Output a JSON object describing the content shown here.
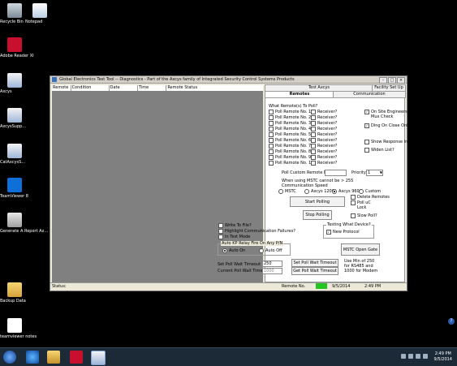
{
  "desktop": {
    "icons": [
      {
        "label": "Recycle Bin",
        "icon": "recycle-bin-icon"
      },
      {
        "label": "Notepad",
        "icon": "notepad-icon"
      },
      {
        "label": "Adobe Reader XI",
        "icon": "adobe-reader-icon"
      },
      {
        "label": "Axcys",
        "icon": "axcys-icon"
      },
      {
        "label": "AxcysSupp...",
        "icon": "axcys-support-icon"
      },
      {
        "label": "CatAxcysS...",
        "icon": "cat-axcys-icon"
      },
      {
        "label": "TeamViewer 8",
        "icon": "teamviewer-icon"
      },
      {
        "label": "Generate A Report Ax...",
        "icon": "report-icon"
      },
      {
        "label": "Backup Data",
        "icon": "folder-icon"
      },
      {
        "label": "teamviewer notes",
        "icon": "document-icon"
      }
    ]
  },
  "window": {
    "title": "Global Electronics Test Tool -- Diagnostics - Part of the Axcys family of Integrated Security Control Systems Products",
    "controls": {
      "minimize": "–",
      "maximize": "□",
      "close": "×"
    },
    "list_columns": [
      "Remote",
      "Condition",
      "Date",
      "Time",
      "Remote Status"
    ],
    "tabs": {
      "row1": [
        "Test Axcys",
        "Facility Set Up"
      ],
      "row2": [
        "Remotes",
        "Communication"
      ]
    },
    "remotes": {
      "section_label": "What Remote(s) To Poll?",
      "poll_items": [
        "Poll Remote No. 1",
        "Poll Remote No. 2",
        "Poll Remote No. 3",
        "Poll Remote No. 4",
        "Poll Remote No. 5",
        "Poll Remote No. 6",
        "Poll Remote No. 7",
        "Poll Remote No. 8",
        "Poll Remote No. 9",
        "Poll Remote No. 10"
      ],
      "receiver_label": "Receiver?",
      "options": [
        {
          "label": "On Site Engineers Mux Check",
          "checked": true
        },
        {
          "label": "Ding On Close Only",
          "checked": true
        },
        {
          "label": "Show Response In Hex",
          "checked": false
        },
        {
          "label": "Widen List?",
          "checked": false
        }
      ],
      "poll_custom_label": "Poll Custom Remote No.",
      "priority_label": "Priority",
      "priority_value": "1",
      "mstc_note": "When using MSTC cannot be > 255",
      "comm_speed_label": "Communication Speed",
      "speeds": [
        {
          "label": "MSTC",
          "selected": false
        },
        {
          "label": "Axcys 1200",
          "selected": false
        },
        {
          "label": "Axcys 9600",
          "selected": true
        },
        {
          "label": "Custom",
          "selected": false
        }
      ],
      "start_polling": "Start Polling",
      "stop_polling": "Stop Polling",
      "side_checks": [
        "Delete Remotes",
        "Poll uC Lock",
        "Slow Poll?"
      ],
      "write_to_file": "Write To File?",
      "highlight_failures": "Highlight Communication Failures?",
      "in_test_mode": "In Test Mode",
      "testing_what_device": "Testing What Device?",
      "new_protocol": "New Protocol",
      "auto_kp_label": "Auto KP Relay Fire On Any P/N",
      "auto_on": "Auto On",
      "auto_off": "Auto Off",
      "mstc_open_gate": "MSTC Open Gate",
      "set_poll_wait_timeout_label": "Set Poll Wait Timeout",
      "set_poll_wait_value": "250",
      "current_poll_wait_label": "Current Poll Wait Timeout",
      "current_poll_wait_value": "1000",
      "set_poll_wait_button": "Set Poll Wait Timeout",
      "get_poll_wait_button": "Get Poll Wait Timeout",
      "timeout_note": "Use Min of 250 for RS485 and 1000 for Modem"
    },
    "status": {
      "status_label": "Status:",
      "remote_no_label": "Remote No.",
      "date": "9/5/2014",
      "time": "2:49 PM",
      "indicator_color": "#22c522"
    }
  },
  "taskbar": {
    "clock_time": "2:49 PM",
    "clock_date": "9/5/2014"
  }
}
